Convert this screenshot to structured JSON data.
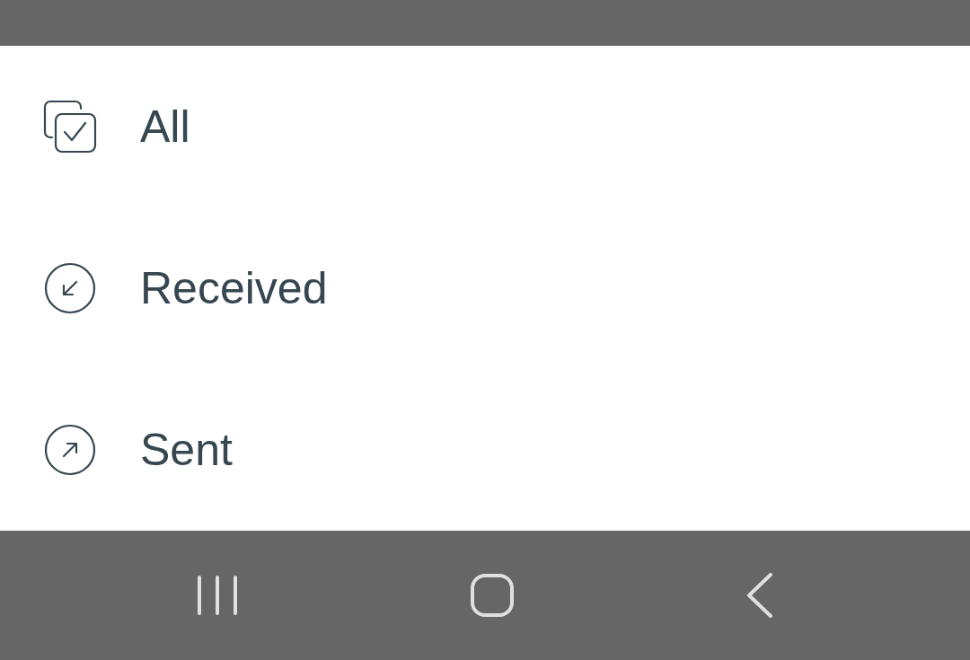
{
  "menu": {
    "items": [
      {
        "label": "All",
        "kind": "all"
      },
      {
        "label": "Received",
        "kind": "received"
      },
      {
        "label": "Sent",
        "kind": "sent"
      }
    ]
  }
}
